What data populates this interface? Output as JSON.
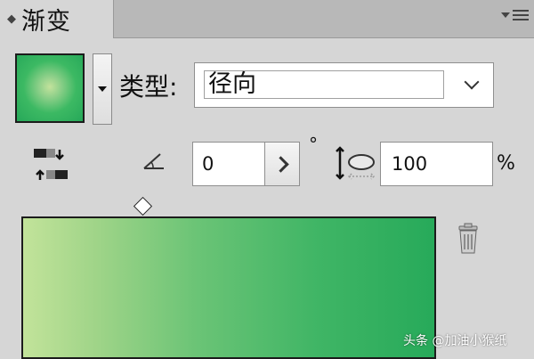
{
  "panel": {
    "collapse_glyph": "◆",
    "title": "渐变",
    "menu_icon": "panel-menu-icon"
  },
  "fill": {
    "swatch_gradient": "radial",
    "swatch_colors": [
      "#c3e29c",
      "#26a859"
    ],
    "dropdown_icon": "triangle-down-icon"
  },
  "type": {
    "label": "类型:",
    "value": "径向",
    "chevron_icon": "chevron-down-icon"
  },
  "controls": {
    "reverse_icon": "reverse-gradient-icon",
    "angle_icon": "angle-icon",
    "angle_value": "0",
    "degree_symbol": "°",
    "aspect_icon": "aspect-ratio-icon",
    "aspect_value": "100",
    "percent_symbol": "%"
  },
  "gradient_slider": {
    "stop_colors": [
      "#c2e39a",
      "#27aa5a"
    ],
    "trash_icon": "trash-icon"
  },
  "watermark": "头条 @加油小猴纸"
}
